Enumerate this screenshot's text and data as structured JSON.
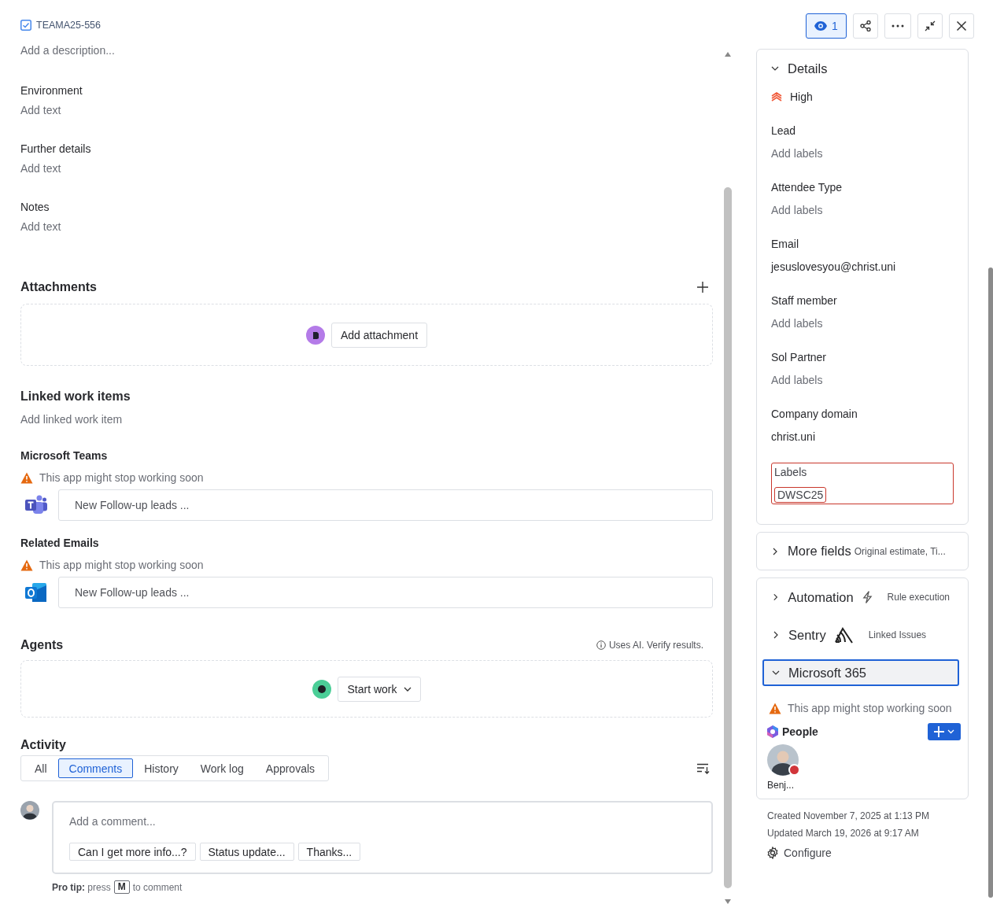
{
  "header": {
    "issue_key": "TEAMA25-556",
    "watchers": "1",
    "watching": true
  },
  "description": {
    "placeholder": "Add a description..."
  },
  "fields": [
    {
      "label": "Environment",
      "placeholder": "Add text"
    },
    {
      "label": "Further details",
      "placeholder": "Add text"
    },
    {
      "label": "Notes",
      "placeholder": "Add text"
    }
  ],
  "attachments": {
    "title": "Attachments",
    "button": "Add attachment"
  },
  "linked": {
    "title": "Linked work items",
    "placeholder": "Add linked work item"
  },
  "apps": [
    {
      "kind": "teams",
      "title": "Microsoft Teams",
      "warning": "This app might stop working soon",
      "value": "New Follow-up leads ..."
    },
    {
      "kind": "outlook",
      "title": "Related Emails",
      "warning": "This app might stop working soon",
      "value": "New Follow-up leads ..."
    }
  ],
  "agents": {
    "title": "Agents",
    "note": "Uses AI. Verify results.",
    "button": "Start work"
  },
  "activity": {
    "title": "Activity",
    "tabs": [
      {
        "label": "All",
        "selected": false
      },
      {
        "label": "Comments",
        "selected": true
      },
      {
        "label": "History",
        "selected": false
      },
      {
        "label": "Work log",
        "selected": false
      },
      {
        "label": "Approvals",
        "selected": false
      }
    ],
    "comment": {
      "placeholder": "Add a comment...",
      "suggestions": [
        "Can I get more info...?",
        "Status update...",
        "Thanks..."
      ]
    },
    "pro_tip": {
      "lead": "**Pro tip:** press",
      "key": "M",
      "after": "to comment"
    }
  },
  "details": {
    "title": "Details",
    "expanded": true,
    "fields": [
      {
        "kind": "priority",
        "value": "High"
      },
      {
        "kind": "empty",
        "label": "Lead",
        "value": "Add labels"
      },
      {
        "kind": "empty",
        "label": "Attendee Type",
        "value": "Add labels"
      },
      {
        "kind": "text",
        "label": "Email",
        "value": "jesuslovesyou@christ.uni"
      },
      {
        "kind": "empty",
        "label": "Staff member",
        "value": "Add labels"
      },
      {
        "kind": "empty",
        "label": "Sol Partner",
        "value": "Add labels"
      },
      {
        "kind": "text",
        "label": "Company domain",
        "value": "christ.uni"
      },
      {
        "kind": "tag",
        "label": "Labels",
        "value": "DWSC25"
      }
    ]
  },
  "more_fields": {
    "title": "More fields",
    "summary": "Original estimate, Ti...",
    "expanded": false
  },
  "integrations": [
    {
      "kind": "automation",
      "title": "Automation",
      "summary": "Rule execution",
      "expanded": false,
      "focused": false
    },
    {
      "kind": "sentry",
      "title": "Sentry",
      "summary": "Linked Issues",
      "expanded": false,
      "focused": false
    },
    {
      "kind": "m365",
      "title": "Microsoft 365",
      "expanded": true,
      "focused": true
    }
  ],
  "m365": {
    "warning": "This app might stop working soon",
    "people_title": "People",
    "people": [
      {
        "name": "Benj...",
        "color": "#d1353a"
      }
    ]
  },
  "created": "Created November 7, 2025 at 1:13 PM",
  "updated": "Updated March 19, 2026 at 9:17 AM",
  "configure": "Configure"
}
